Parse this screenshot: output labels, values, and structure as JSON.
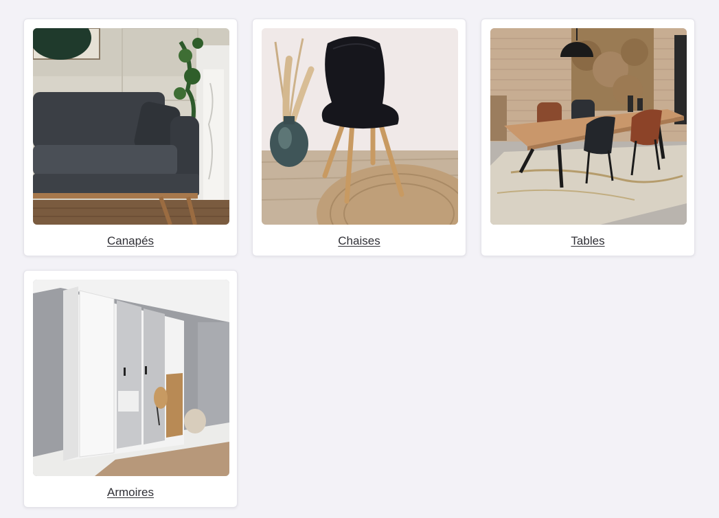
{
  "categories": [
    {
      "label": "Canapés",
      "image": "sofa-photo"
    },
    {
      "label": "Chaises",
      "image": "chair-photo"
    },
    {
      "label": "Tables",
      "image": "dining-table-photo"
    },
    {
      "label": "Armoires",
      "image": "wardrobe-photo"
    }
  ]
}
